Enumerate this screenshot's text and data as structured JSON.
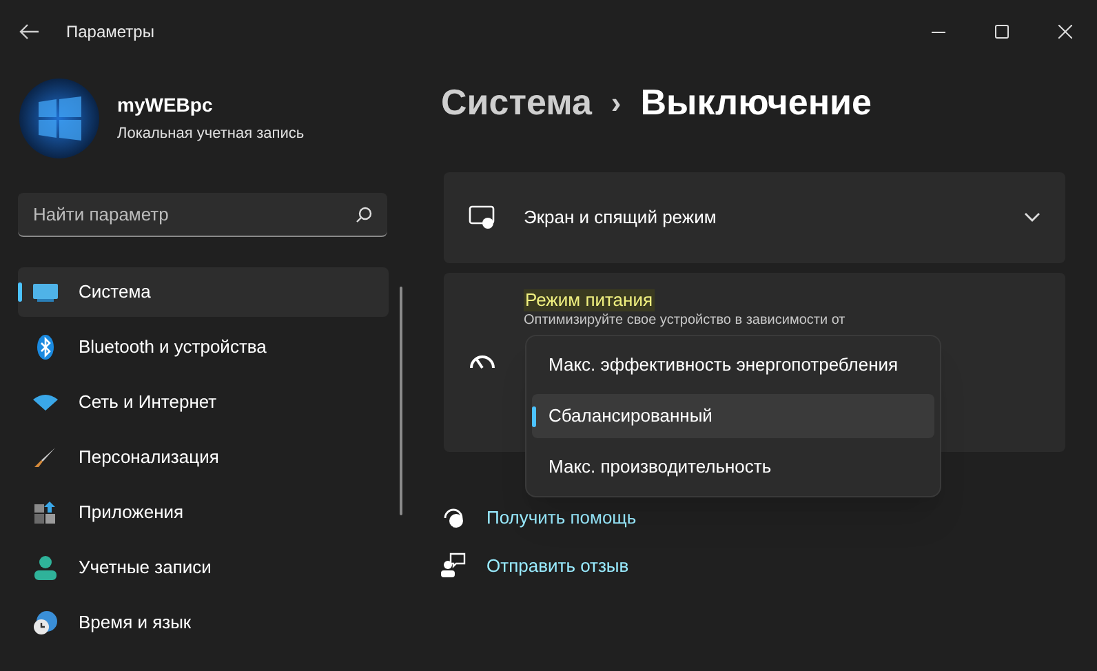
{
  "window": {
    "title": "Параметры"
  },
  "account": {
    "name": "myWEBpc",
    "type": "Локальная учетная запись"
  },
  "search": {
    "placeholder": "Найти параметр"
  },
  "sidebar": {
    "items": [
      {
        "label": "Система",
        "kind": "system",
        "selected": true
      },
      {
        "label": "Bluetooth и устройства",
        "kind": "bluetooth",
        "selected": false
      },
      {
        "label": "Сеть и Интернет",
        "kind": "network",
        "selected": false
      },
      {
        "label": "Персонализация",
        "kind": "brush",
        "selected": false
      },
      {
        "label": "Приложения",
        "kind": "apps",
        "selected": false
      },
      {
        "label": "Учетные записи",
        "kind": "person",
        "selected": false
      },
      {
        "label": "Время и язык",
        "kind": "clock",
        "selected": false
      }
    ]
  },
  "breadcrumb": {
    "parent": "Система",
    "separator": "›",
    "current": "Выключение"
  },
  "cards": [
    {
      "kind": "expander",
      "label": "Экран и спящий режим",
      "expanded": false
    },
    {
      "kind": "power",
      "label": "Режим питания",
      "description": "Оптимизируйте свое устройство в зависимости от"
    }
  ],
  "power_menu": {
    "options": [
      {
        "label": "Макс. эффективность энергопотребления",
        "selected": false
      },
      {
        "label": "Сбалансированный",
        "selected": true
      },
      {
        "label": "Макс. производительность",
        "selected": false
      }
    ]
  },
  "links": [
    {
      "label": "Получить помощь",
      "kind": "help"
    },
    {
      "label": "Отправить отзыв",
      "kind": "feedback"
    }
  ]
}
